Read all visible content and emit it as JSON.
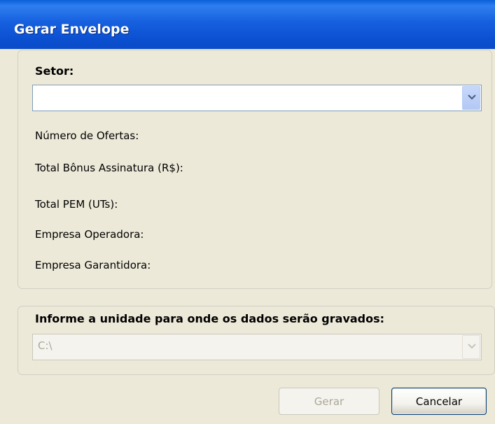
{
  "window": {
    "title": "Gerar Envelope"
  },
  "setor": {
    "label": "Setor:",
    "value": "",
    "icon": "chevron-down-icon"
  },
  "info_fields": [
    "Número de Ofertas:",
    "Total Bônus Assinatura (R$):",
    "Total PEM (UTs):",
    "Empresa Operadora:",
    "Empresa Garantidora:"
  ],
  "drive": {
    "label": "Informe a unidade para onde os dados serão gravados:",
    "value": "C:\\",
    "enabled": false
  },
  "buttons": {
    "gerar": {
      "label": "Gerar",
      "enabled": false
    },
    "cancelar": {
      "label": "Cancelar",
      "enabled": true
    }
  },
  "colors": {
    "titlebar": "#0a54d6",
    "dialog_bg": "#ece9d8",
    "combo_border": "#7f9db9",
    "disabled_text": "#aca899"
  }
}
